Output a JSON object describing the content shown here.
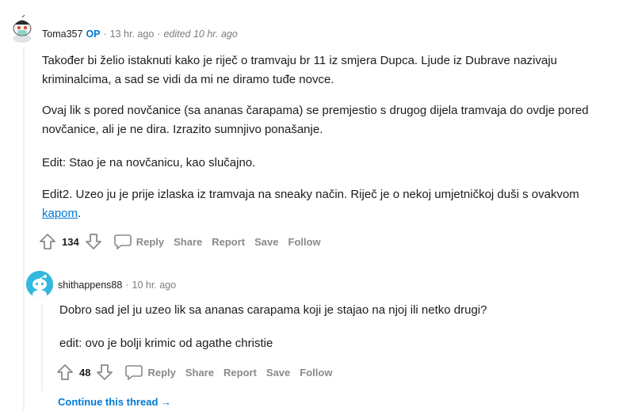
{
  "comment": {
    "author": "Toma357",
    "op_badge": "OP",
    "dot1": "·",
    "time": "13 hr. ago",
    "dot2": "·",
    "edited": "edited 10 hr. ago",
    "paragraphs": [
      "Također bi želio istaknuti kako je riječ o tramvaju br 11 iz smjera Dupca. Ljude iz Dubrave nazivaju kriminalcima, a sad se vidi da mi ne diramo tuđe novce.",
      "Ovaj lik s pored novčanice (sa ananas čarapama) se premjestio s drugog dijela tramvaja do ovdje pored novčanice, ali je ne dira. Izrazito sumnjivo ponašanje.",
      "Edit: Stao je na novčanicu, kao slučajno."
    ],
    "last_paragraph_prefix": "Edit2. Uzeo ju je prije izlaska iz tramvaja na sneaky način. Riječ je o nekoj umjetničkoj duši s ovakvom ",
    "last_paragraph_link": "kapom",
    "last_paragraph_suffix": ".",
    "score": "134",
    "actions": {
      "reply": "Reply",
      "share": "Share",
      "report": "Report",
      "save": "Save",
      "follow": "Follow"
    }
  },
  "reply": {
    "author": "shithappens88",
    "dot": "·",
    "time": "10 hr. ago",
    "paragraphs": [
      "Dobro sad jel ju uzeo lik sa ananas carapama koji je stajao na njoj ili netko drugi?",
      "edit: ovo je bolji krimic od agathe christie"
    ],
    "score": "48",
    "actions": {
      "reply": "Reply",
      "share": "Share",
      "report": "Report",
      "save": "Save",
      "follow": "Follow"
    }
  },
  "continue_thread": "Continue this thread",
  "continue_arrow": "→",
  "colors": {
    "link": "#0079d3",
    "meta": "#7c7c7c",
    "action": "#878a8c",
    "reply_avatar": "#32b8df"
  },
  "icons": [
    "upvote-icon",
    "downvote-icon",
    "comment-bubble-icon",
    "snoo-avatar-icon"
  ]
}
